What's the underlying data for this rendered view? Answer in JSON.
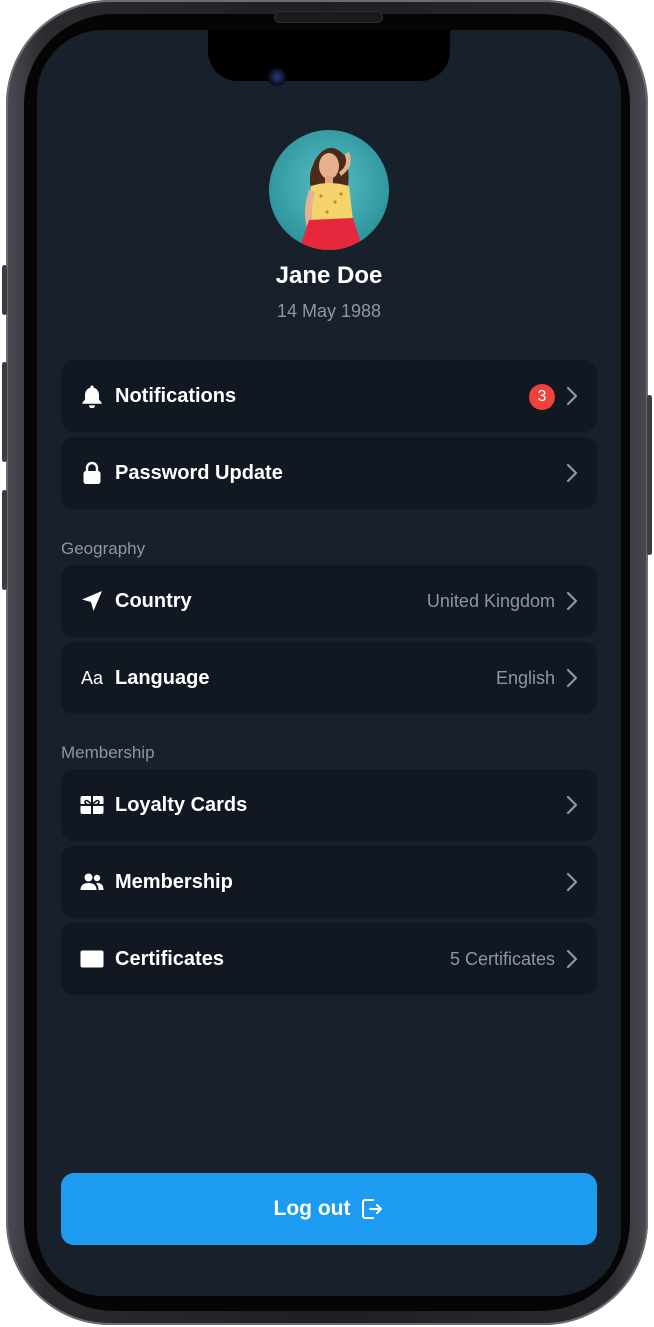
{
  "profile": {
    "name": "Jane Doe",
    "dob": "14 May 1988"
  },
  "account_rows": [
    {
      "label": "Notifications",
      "icon": "bell-icon",
      "badge": "3"
    },
    {
      "label": "Password Update",
      "icon": "lock-icon"
    }
  ],
  "geography": {
    "title": "Geography",
    "rows": [
      {
        "label": "Country",
        "icon": "location-arrow-icon",
        "value": "United Kingdom"
      },
      {
        "label": "Language",
        "icon": "text-aa-icon",
        "icon_text": "Aa",
        "value": "English"
      }
    ]
  },
  "membership": {
    "title": "Membership",
    "rows": [
      {
        "label": "Loyalty Cards",
        "icon": "gift-card-icon"
      },
      {
        "label": "Membership",
        "icon": "people-icon"
      },
      {
        "label": "Certificates",
        "icon": "certificate-card-icon",
        "value": "5 Certificates"
      }
    ]
  },
  "logout": {
    "label": "Log out",
    "icon": "logout-icon"
  },
  "colors": {
    "background": "#18202b",
    "row_background": "#111821",
    "accent": "#1d9bf0",
    "badge": "#f0413a",
    "muted_text": "#8d96a3"
  }
}
